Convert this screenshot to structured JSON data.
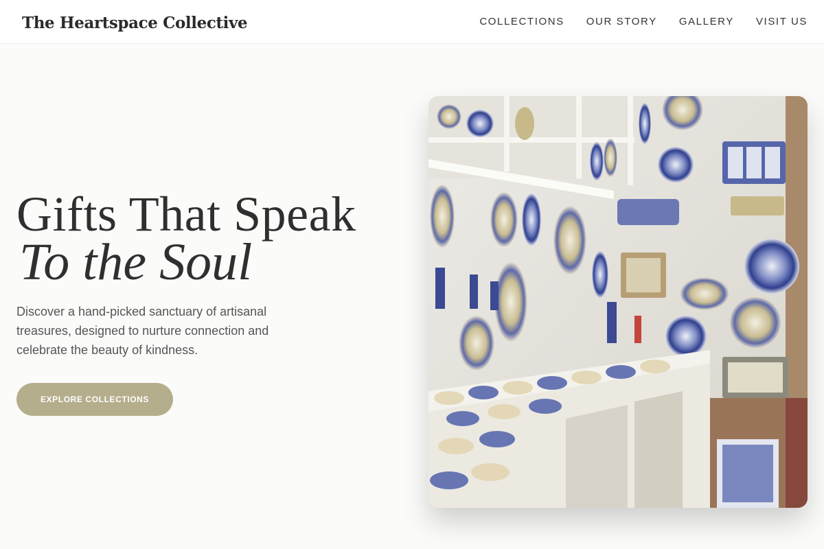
{
  "header": {
    "brand": "The Heartspace Collective",
    "nav": [
      "COLLECTIONS",
      "OUR STORY",
      "GALLERY",
      "VISIT US"
    ]
  },
  "hero": {
    "headline_line1": "Gifts That Speak",
    "headline_line2": "To the Soul",
    "description": "Discover a hand-picked sanctuary of artisanal treasures, designed to nurture connection and celebrate the beauty of kindness.",
    "cta_label": "EXPLORE COLLECTIONS",
    "image_subject": "shop wall of hand-painted ceramic plates and pottery on shelves"
  },
  "colors": {
    "background": "#fbfbfa",
    "header": "#ffffff",
    "cta": "#b5ae8c",
    "text": "#2f2f2f"
  }
}
